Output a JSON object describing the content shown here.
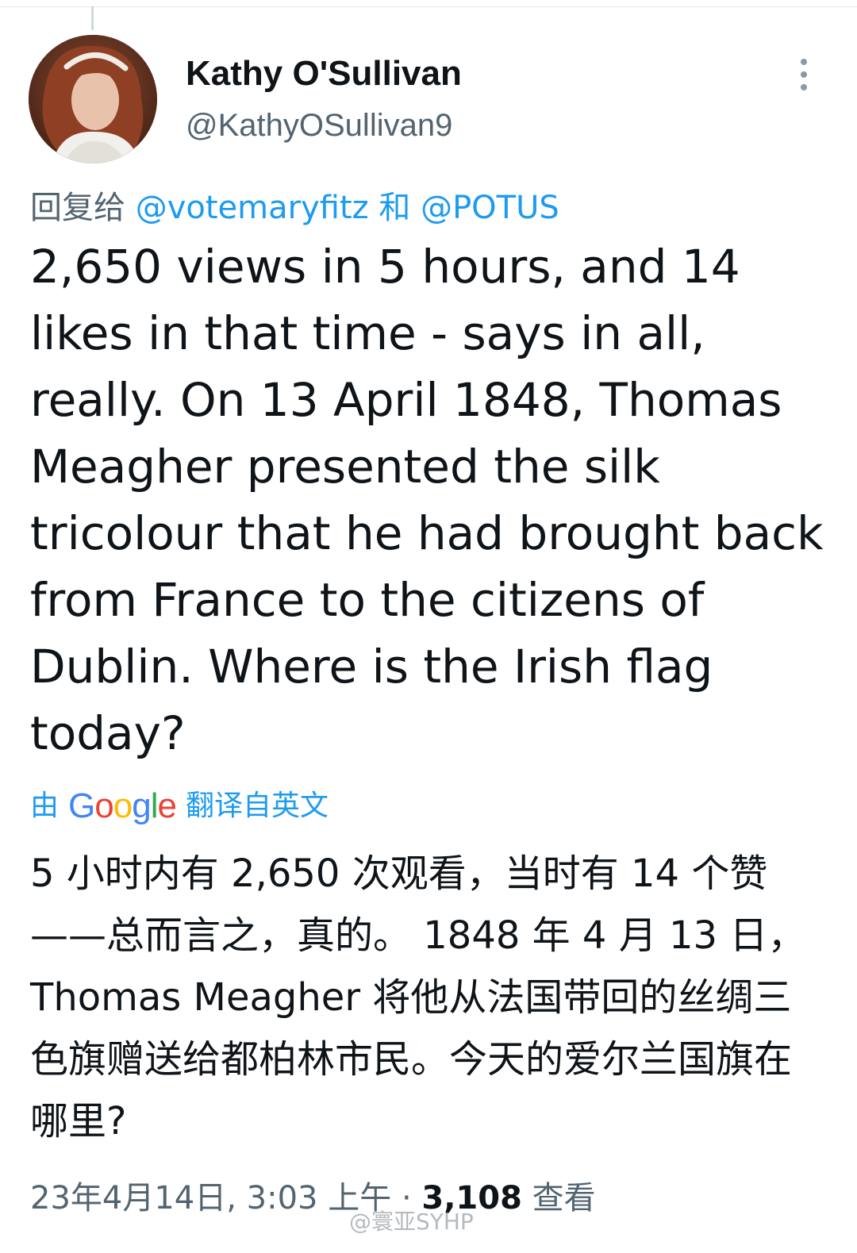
{
  "tweet": {
    "author_name": "Kathy O'Sullivan",
    "author_handle": "@KathyOSullivan9",
    "reply_prefix": "回复给",
    "reply_mention_1": "@votemaryfitz",
    "reply_joiner": "和",
    "reply_mention_2": "@POTUS",
    "text": "2,650 views in 5 hours, and 14 likes in that time - says in all, really. On 13 April 1848, Thomas Meagher presented the silk tricolour that he had brought back from France to the citizens of Dublin. Where is the Irish flag today?",
    "translate_prefix": "由",
    "translate_brand": "Google",
    "translate_suffix": "翻译自英文",
    "translated_text": "5 小时内有 2,650 次观看，当时有 14 个赞——总而言之，真的。 1848 年 4 月 13 日，Thomas Meagher 将他从法国带回的丝绸三色旗赠送给都柏林市民。今天的爱尔兰国旗在哪里?",
    "timestamp": "23年4月14日, 3:03 上午",
    "separator": "·",
    "views_count": "3,108",
    "views_label": "查看"
  },
  "watermark": "@寰亚SYHP",
  "icons": {
    "more": "more-vertical-icon"
  },
  "colors": {
    "link": "#1d9bf0",
    "secondary_text": "#536471",
    "primary_text": "#0f1419"
  }
}
